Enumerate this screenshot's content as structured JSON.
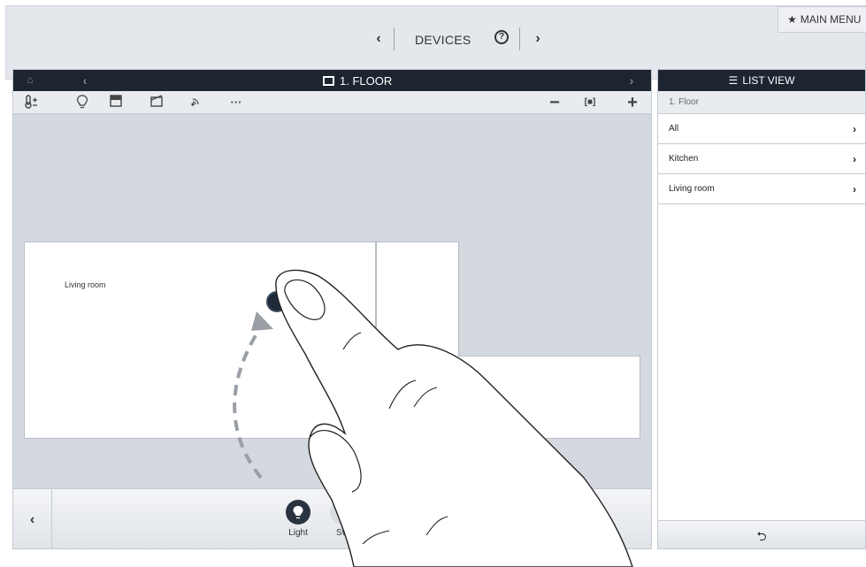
{
  "header": {
    "title": "DEVICES",
    "prev_symbol": "‹",
    "next_symbol": "›",
    "help_symbol": "?",
    "main_menu_star": "★",
    "main_menu_label": "MAIN MENU"
  },
  "floorplan": {
    "title": "1. FLOOR",
    "home_symbol": "⌂",
    "back_symbol": "‹",
    "forward_symbol": "›",
    "toolbar": {
      "more_label": "···",
      "zoom_out_label": "−",
      "fit_label": "[■]",
      "zoom_in_label": "+"
    },
    "room_label": "Living room",
    "bottom": {
      "prev_symbol": "‹",
      "items": [
        {
          "label": "Light",
          "icon": "light-bulb-icon"
        },
        {
          "label": "Sw",
          "icon": "switch-icon"
        }
      ]
    }
  },
  "listview": {
    "title": "LIST VIEW",
    "header": "1. Floor",
    "items": [
      {
        "label": "All"
      },
      {
        "label": "Kitchen"
      },
      {
        "label": "Living room"
      }
    ],
    "chevron": "›",
    "back_symbol": "⮌"
  },
  "colors": {
    "titlebar_bg": "#1d2530",
    "panel_bg": "#d4d9e0",
    "header_bg": "#e4e7ec"
  }
}
